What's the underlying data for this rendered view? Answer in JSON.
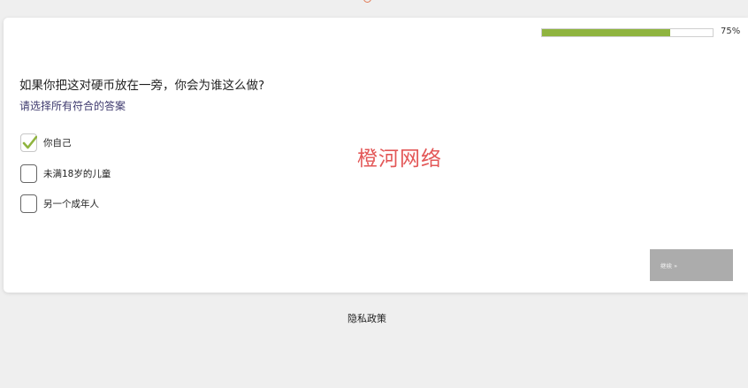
{
  "progress": {
    "value": 0.75,
    "label": "75%"
  },
  "question": {
    "title": "如果你把这对硬币放在一旁，你会为谁这么做?",
    "hint": "请选择所有符合的答案"
  },
  "options": [
    {
      "label": "你自己",
      "checked": true
    },
    {
      "label": "未满18岁的儿童",
      "checked": false
    },
    {
      "label": "另一个成年人",
      "checked": false
    }
  ],
  "watermark": "橙河网络",
  "continue_label": "继续 »",
  "footer": {
    "privacy_label": "隐私政策"
  },
  "colors": {
    "accent": "#8fb43f",
    "checkmark": "#8fb43f",
    "watermark": "#e35757",
    "button": "#acacac"
  }
}
